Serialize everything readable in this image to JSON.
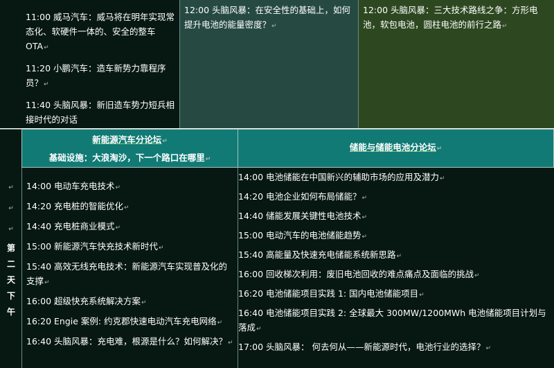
{
  "top": {
    "schedule": [
      {
        "text": "11:00 威马汽车：威马将在明年实现常态化、软硬件一体的、安全的整车OTA"
      },
      {
        "text": "11:20 小鹏汽车：造车新势力靠程序员？"
      },
      {
        "text": "11:40 头脑风暴：新旧造车势力短兵相接时代的对话"
      }
    ],
    "middle": "12:00 头脑风暴：在安全性的基础上，如何提升电池的能量密度？",
    "right": "12:00 头脑风暴：三大技术路线之争：方形电池，软包电池，圆柱电池的前行之路"
  },
  "day_label": [
    "第",
    "二",
    "天",
    "下",
    "午"
  ],
  "day_marks": [
    "↵",
    "↵",
    "↵"
  ],
  "return_mark": "↵",
  "forum_left": {
    "title": "新能源汽车分论坛",
    "subtitle": "基础设施：大浪淘沙，下一个路口在哪里",
    "items": [
      "14:00 电动车充电技术",
      "14:20 充电桩的智能优化",
      "14:40 充电桩商业模式",
      "15:00 新能源汽车快充技术新时代",
      "15:40 高效无线充电技术：新能源汽车实现普及化的支撑",
      "16:00 超级快充系统解决方案",
      "16:20 Engie 案例: 约克郡快速电动汽车充电网络",
      "16:40 头脑风暴：充电难，根源是什么？如何解决？"
    ]
  },
  "forum_right": {
    "title": "储能与储能电池分论坛",
    "items": [
      "14:00 电池储能在中国新兴的辅助市场的应用及潜力",
      "14:20 电池企业如何布局储能？",
      "14:40 储能发展关键性电池技术",
      "15:00 电动汽车的电池储能趋势",
      "15:40 高能量及快速充电储能系统新思路",
      "16:00 回收梯次利用：废旧电池回收的难点痛点及面临的挑战",
      "16:20 电池储能项目实践 1: 国内电池储能项目",
      "16:40 电池储能项目实践 2: 全球最大 300MW/1200MWh 电池储能项目计划与落成",
      "17:00 头脑风暴： 何去何从——新能源时代，电池行业的选择？"
    ]
  }
}
